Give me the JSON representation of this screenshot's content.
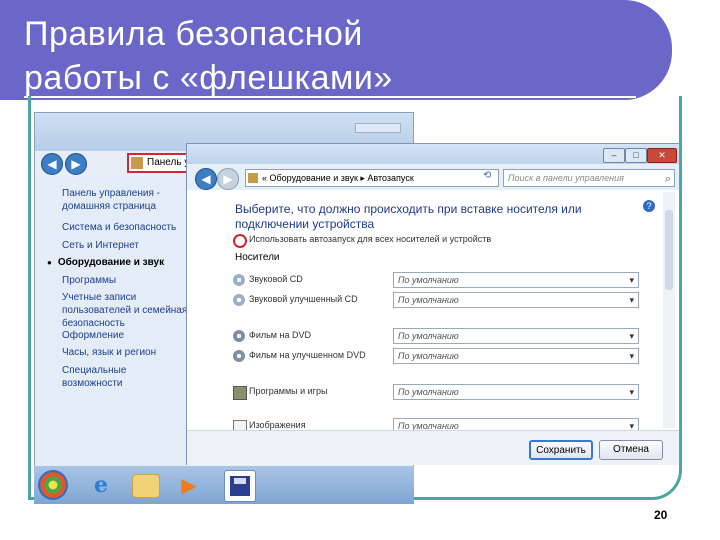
{
  "slide": {
    "title": "Правила безопасной\nработы с «флешками»",
    "page_number": "20"
  },
  "back_window": {
    "address": "Панель упра…",
    "sidebar": [
      "Панель управления - домашняя страница",
      "Система и безопасность",
      "Сеть и Интернет",
      "Оборудование и звук",
      "Программы",
      "Учетные записи пользователей и семейная безопасность",
      "Оформление",
      "Часы, язык и регион",
      "Специальные возможности"
    ]
  },
  "front_window": {
    "address": "« Оборудование и звук ▸ Автозапуск",
    "search_placeholder": "Поиск в панели управления",
    "heading": "Выберите, что должно происходить при вставке носителя или подключении устройства",
    "checkbox_label": "Использовать автозапуск для всех носителей и устройств",
    "section_label": "Носители",
    "media": [
      {
        "label": "Звуковой CD",
        "value": "По умолчанию",
        "icon": "audio-cd-icon"
      },
      {
        "label": "Звуковой улучшенный CD",
        "value": "По умолчанию",
        "icon": "enhanced-cd-icon"
      },
      {
        "label": "Фильм на DVD",
        "value": "По умолчанию",
        "icon": "dvd-icon"
      },
      {
        "label": "Фильм на улучшенном DVD",
        "value": "По умолчанию",
        "icon": "enhanced-dvd-icon"
      },
      {
        "label": "Программы и игры",
        "value": "По умолчанию",
        "icon": "programs-icon"
      },
      {
        "label": "Изображения",
        "value": "По умолчанию",
        "icon": "pictures-icon"
      }
    ],
    "save_label": "Сохранить",
    "cancel_label": "Отмена"
  },
  "colors": {
    "header": "#6a67c8",
    "frame": "#4da69e",
    "highlight": "#d4212b"
  }
}
